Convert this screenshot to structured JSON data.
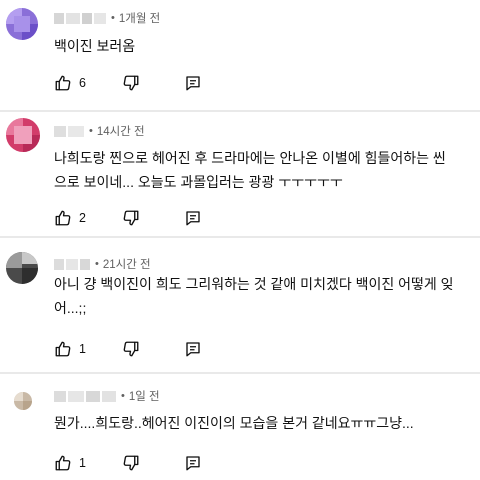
{
  "comments": [
    {
      "author_hidden": "blurred",
      "time": "1개월 전",
      "lines": [
        "백이진 보러옴"
      ],
      "likes": "6",
      "avatar_colors": [
        "#8a6fd8",
        "#b49ef0",
        "#6b4fc8",
        "#a891ea"
      ]
    },
    {
      "author_hidden": "blurred",
      "time": "14시간 전",
      "lines": [
        "나희도랑 찐으로 헤어진 후 드라마에는 안나온 이별에 힘들어하는 씬",
        "으로 보이네... 오늘도 과몰입러는 광광 ㅜㅜㅜㅜㅜ"
      ],
      "likes": "2",
      "avatar_colors": [
        "#d23c6a",
        "#e8789c",
        "#b82a58",
        "#f0a0bc"
      ]
    },
    {
      "author_hidden": "blurred",
      "time": "21시간 전",
      "lines": [
        "아니 걍 백이진이 희도 그리워하는 것 같애 미치겠다 백이진 어떻게 잊",
        "어...;;"
      ],
      "likes": "1",
      "avatar_colors": [
        "#4a4a4a",
        "#9a9a9a",
        "#2e2e2e",
        "#c8c8c8"
      ]
    },
    {
      "author_hidden": "blurred",
      "time": "1일 전",
      "lines": [
        "뭔가....희도랑..헤어진 이진이의 모습을 본거 같네요ㅠㅠ그냥..."
      ],
      "likes": "1",
      "avatar_colors": [
        "#c9b9a6",
        "#e6dccf",
        "#b8a48c",
        "#efe7dd"
      ]
    }
  ],
  "icons": {
    "like": "thumbs-up-icon",
    "dislike": "thumbs-down-icon",
    "reply": "reply-icon"
  }
}
